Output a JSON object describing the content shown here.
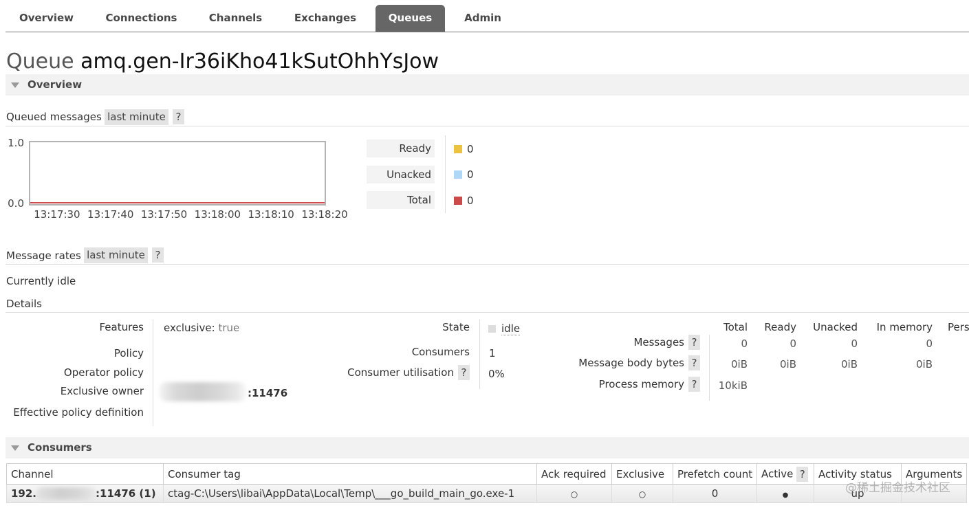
{
  "nav": {
    "tabs": [
      {
        "label": "Overview"
      },
      {
        "label": "Connections"
      },
      {
        "label": "Channels"
      },
      {
        "label": "Exchanges"
      },
      {
        "label": "Queues",
        "active": true
      },
      {
        "label": "Admin"
      }
    ]
  },
  "title": {
    "prefix": "Queue",
    "name": "amq.gen-Ir36iKho41kSutOhhYsJow"
  },
  "overview_section": {
    "label": "Overview",
    "expanded": true
  },
  "queued_messages": {
    "label": "Queued messages",
    "range": "last minute",
    "help": "?"
  },
  "chart_data": {
    "type": "line",
    "xlim": [
      "13:17:25",
      "13:18:20"
    ],
    "ylim": [
      0,
      1
    ],
    "x_ticks": [
      "13:17:30",
      "13:17:40",
      "13:17:50",
      "13:18:00",
      "13:18:10",
      "13:18:20"
    ],
    "y_ticks": [
      {
        "value": 1,
        "label": "1.0"
      },
      {
        "value": 0,
        "label": "0.0"
      }
    ],
    "legend": "right",
    "series": [
      {
        "name": "Ready",
        "color": "#edc240",
        "x": [
          "13:17:25",
          "13:18:20"
        ],
        "values": [
          0,
          0
        ],
        "current": "0"
      },
      {
        "name": "Unacked",
        "color": "#afd8f8",
        "x": [
          "13:17:25",
          "13:18:20"
        ],
        "values": [
          0,
          0
        ],
        "current": "0"
      },
      {
        "name": "Total",
        "color": "#cb4b4b",
        "x": [
          "13:17:25",
          "13:18:20"
        ],
        "values": [
          0,
          0
        ],
        "current": "0"
      }
    ]
  },
  "message_rates": {
    "label": "Message rates",
    "range": "last minute",
    "help": "?",
    "status": "Currently idle"
  },
  "details": {
    "label": "Details",
    "features": {
      "label": "Features",
      "key": "exclusive:",
      "value": "true"
    },
    "policy": {
      "label": "Policy"
    },
    "operator_policy": {
      "label": "Operator policy"
    },
    "exclusive_owner": {
      "label": "Exclusive owner",
      "value": ":11476"
    },
    "effective_policy_definition": {
      "label": "Effective policy definition"
    },
    "state": {
      "label": "State",
      "value": "idle"
    },
    "consumers": {
      "label": "Consumers",
      "value": "1"
    },
    "consumer_utilisation": {
      "label": "Consumer utilisation",
      "help": "?",
      "value": "0%"
    },
    "message_stats": {
      "columns": [
        "Total",
        "Ready",
        "Unacked",
        "In memory",
        "Pers"
      ],
      "rows": [
        {
          "label": "Messages",
          "help": "?",
          "values": [
            "0",
            "0",
            "0",
            "0"
          ]
        },
        {
          "label": "Message body bytes",
          "help": "?",
          "values": [
            "0iB",
            "0iB",
            "0iB",
            "0iB"
          ]
        },
        {
          "label": "Process memory",
          "help": "?",
          "values": [
            "10kiB"
          ]
        }
      ]
    }
  },
  "consumers": {
    "label": "Consumers",
    "expanded": true,
    "columns": [
      "Channel",
      "Consumer tag",
      "Ack required",
      "Exclusive",
      "Prefetch count",
      "Active",
      "Activity status",
      "Arguments"
    ],
    "active_help": "?",
    "rows": [
      {
        "channel_prefix": "192.",
        "channel_suffix": ":11476 (1)",
        "consumer_tag": "ctag-C:\\Users\\libai\\AppData\\Local\\Temp\\___go_build_main_go.exe-1",
        "ack_required": "○",
        "exclusive": "○",
        "prefetch_count": "0",
        "active": "●",
        "activity_status": "up"
      }
    ]
  },
  "watermark": "@稀土掘金技术社区",
  "colors": {
    "active_tab": "#666666",
    "section_bar": "#f2f2f2",
    "help_box": "#e3e3e3",
    "state_idle": "#dddddd"
  }
}
